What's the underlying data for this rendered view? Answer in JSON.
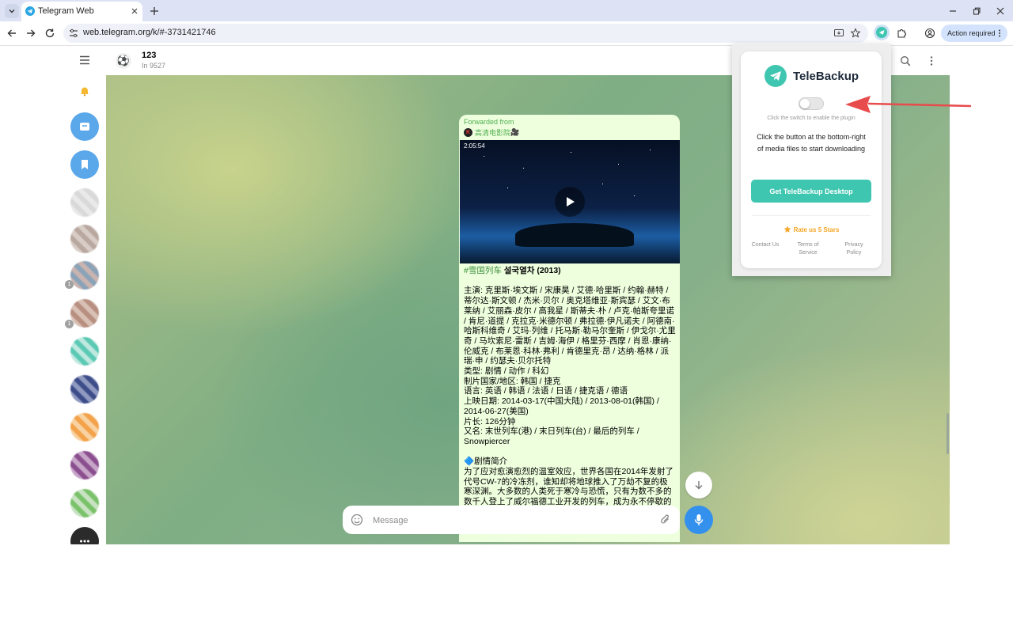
{
  "browser": {
    "tab_title": "Telegram Web",
    "url": "web.telegram.org/k/#-3731421746",
    "action_required": "Action required"
  },
  "colors": {
    "telegram_blue": "#3390ec",
    "bubble_green": "#eeffde",
    "teal_button": "#3fc6b0",
    "rate_orange": "#f5a623",
    "annotation_red": "#e84b4b"
  },
  "sidebar": {
    "items": [
      {
        "icon": "menu-icon"
      },
      {
        "icon": "bell-icon"
      },
      {
        "icon": "archive-folder-icon"
      },
      {
        "icon": "saved-messages-icon"
      }
    ],
    "badges": [
      "1",
      "1"
    ]
  },
  "chat": {
    "title": "123",
    "subtitle": "In 9527",
    "avatar_emoji": "⚽"
  },
  "message": {
    "forwarded_label": "Forwarded from",
    "source_name": "高清电影院",
    "source_emoji": "🎥",
    "video_duration": "2:05:54",
    "hashtag": "#雪国列车",
    "title_rest": "설국열차 (2013)",
    "cast": "主演: 克里斯·埃文斯 / 宋康昊 / 艾德·哈里斯 / 约翰·赫特 / 蒂尔达·斯文顿 / 杰米·贝尔 / 奥克塔维亚·斯宾瑟 / 艾文·布莱纳 / 艾丽森·皮尔 / 高我星 / 斯蒂夫·朴 / 卢克·帕斯夸里诺 / 肯尼·道提 / 克拉克·米德尔顿 / 弗拉德·伊凡诺夫 / 阿德南·哈斯科维奇 / 艾玛·列维 / 托马斯·勒马尔奎斯 / 伊戈尔·尤里奇 / 马坎索尼·雷斯 / 吉姆·海伊 / 格里芬·西摩 / 肖恩·康纳·伦威克 / 布莱恩·科林·弗利 / 肯德里克·昂 / 达纳·格林 / 派瑞·申 / 约瑟夫·贝尔托特",
    "genre": "类型: 剧情 / 动作 / 科幻",
    "country": "制片国家/地区: 韩国 / 捷克",
    "language": "语言: 英语 / 韩语 / 法语 / 日语 / 捷克语 / 德语",
    "release": "上映日期: 2014-03-17(中国大陆) / 2013-08-01(韩国) / 2014-06-27(美国)",
    "runtime": "片长: 126分钟",
    "aka": "又名: 末世列车(港) / 末日列车(台) / 最后的列车 / Snowpiercer",
    "synopsis_icon": "🔷",
    "synopsis_title": "剧情简介",
    "synopsis": "为了应对愈演愈烈的温室效应，世界各国在2014年发射了代号CW-7的冷冻剂，谁知却将地球推入了万劫不复的极寒深渊。大多数的人类死于寒冷与恐慌，只有为数不多的数千人登上了威尔福德工业开发的列车，成为永不停歇的"
  },
  "composer": {
    "placeholder": "Message"
  },
  "extension": {
    "name": "TeleBackup",
    "toggle_on": false,
    "hint": "Click the switch to enable the plugin",
    "description": "Click the button at the bottom-right of media files to start downloading",
    "cta": "Get TeleBackup Desktop",
    "rate": "Rate us 5 Stars",
    "footer_links": [
      "Contact Us",
      "Terms of Service",
      "Privacy Policy"
    ]
  }
}
